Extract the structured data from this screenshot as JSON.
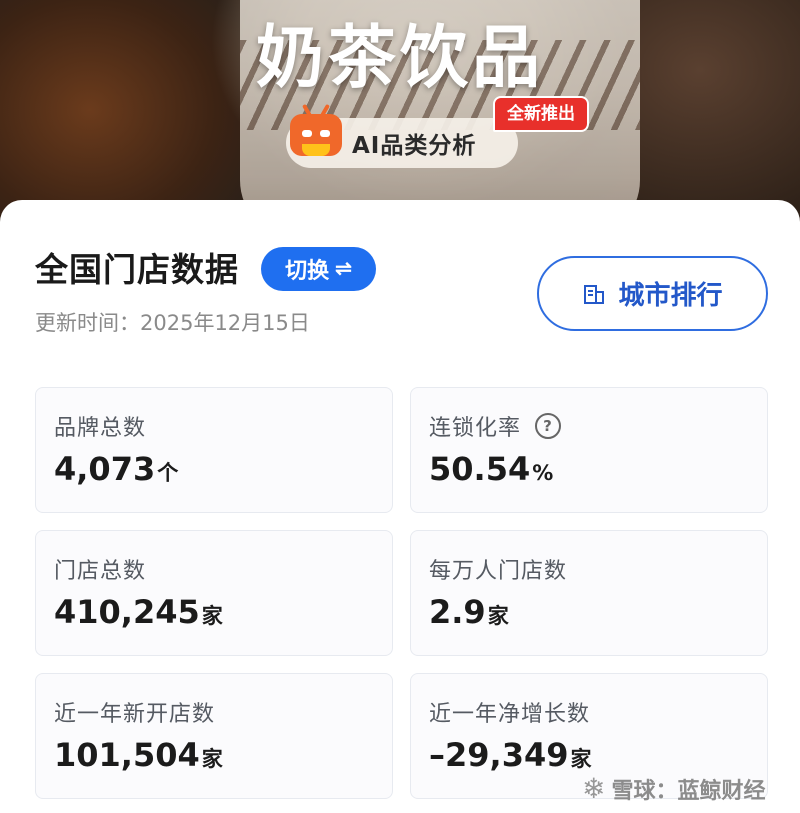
{
  "hero": {
    "title": "奶茶饮品",
    "ai_button_label": "AI品类分析",
    "new_badge": "全新推出"
  },
  "header": {
    "title": "全国门店数据",
    "switch_label": "切换",
    "switch_icon": "⇌",
    "update_time": "更新时间：2025年12月15日",
    "city_rank_label": "城市排行",
    "city_rank_icon": "building-icon"
  },
  "stats": [
    {
      "label": "品牌总数",
      "value": "4,073",
      "unit": "个",
      "help": false
    },
    {
      "label": "连锁化率",
      "value": "50.54",
      "unit": "%",
      "help": true
    },
    {
      "label": "门店总数",
      "value": "410,245",
      "unit": "家",
      "help": false
    },
    {
      "label": "每万人门店数",
      "value": "2.9",
      "unit": "家",
      "help": false
    },
    {
      "label": "近一年新开店数",
      "value": "101,504",
      "unit": "家",
      "help": false
    },
    {
      "label": "近一年净增长数",
      "value": "–29,349",
      "unit": "家",
      "help": false
    }
  ],
  "watermark": {
    "text": "雪球：蓝鲸财经"
  },
  "colors": {
    "accent_blue": "#1f6ff0",
    "badge_red": "#e8302b",
    "robot_orange": "#f0682a"
  }
}
